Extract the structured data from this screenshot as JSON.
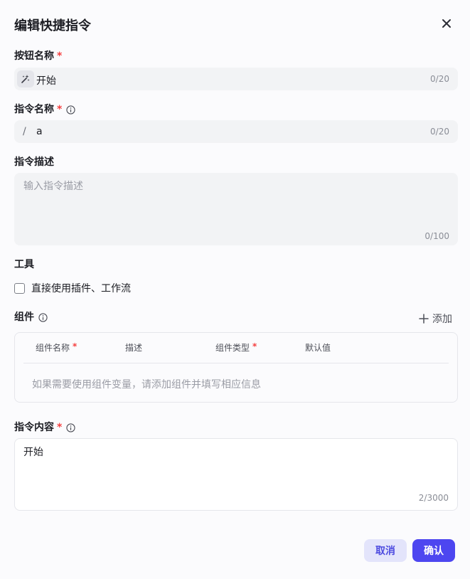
{
  "dialog": {
    "title": "编辑快捷指令",
    "close_icon": "close-icon"
  },
  "button_name": {
    "label": "按钮名称",
    "required_mark": "*",
    "icon": "magic-wand-icon",
    "value": "开始",
    "count": "0/20"
  },
  "command_name": {
    "label": "指令名称",
    "required_mark": "*",
    "info_icon": "info-icon",
    "prefix": "/",
    "value": "a",
    "count": "0/20"
  },
  "command_desc": {
    "label": "指令描述",
    "placeholder": "输入指令描述",
    "count": "0/100"
  },
  "tools": {
    "label": "工具",
    "checkbox_label": "直接使用插件、工作流",
    "checked": false
  },
  "components": {
    "label": "组件",
    "info_icon": "info-icon",
    "add_label": "添加",
    "columns": [
      {
        "label": "组件名称",
        "required": "*"
      },
      {
        "label": "描述",
        "required": ""
      },
      {
        "label": "组件类型",
        "required": "*"
      },
      {
        "label": "默认值",
        "required": ""
      }
    ],
    "empty_text": "如果需要使用组件变量，请添加组件并填写相应信息"
  },
  "command_content": {
    "label": "指令内容",
    "required_mark": "*",
    "info_icon": "info-icon",
    "value": "开始",
    "count": "2/3000"
  },
  "footer": {
    "cancel_label": "取消",
    "confirm_label": "确认"
  },
  "colors": {
    "accent": "#4d46f0",
    "required": "#f53f3f",
    "cancel_bg": "#e3e4fb"
  }
}
